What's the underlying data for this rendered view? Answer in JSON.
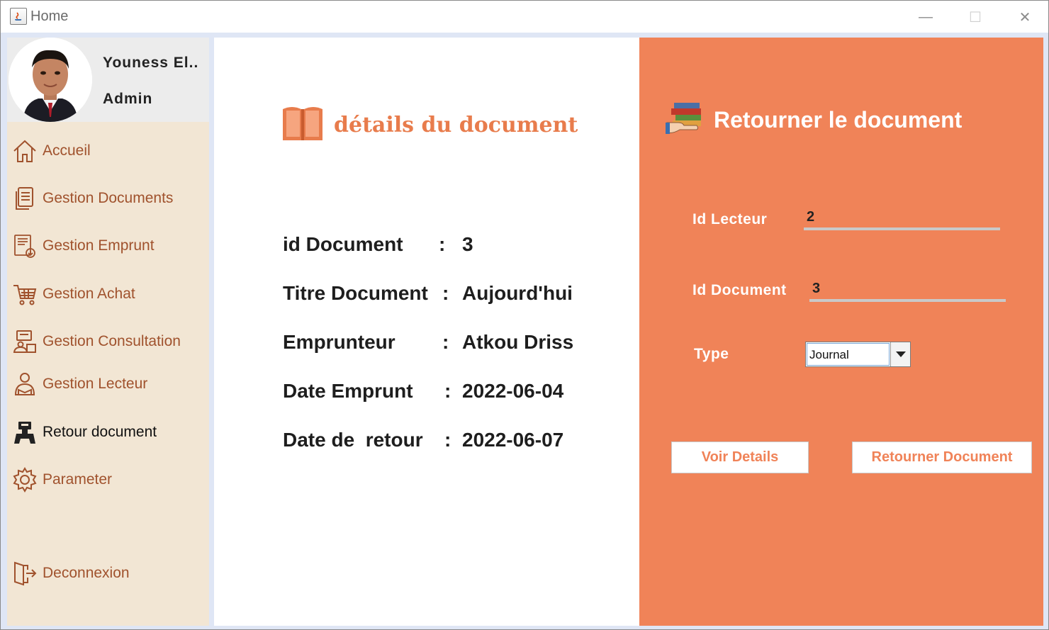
{
  "window": {
    "title": "Home",
    "minimize": "—",
    "maximize": "☐",
    "close": "✕"
  },
  "profile": {
    "name": "Youness El..",
    "role": "Admin"
  },
  "sidebar": {
    "items": [
      {
        "label": "Accueil",
        "icon": "home-icon"
      },
      {
        "label": "Gestion Documents",
        "icon": "documents-icon"
      },
      {
        "label": "Gestion Emprunt",
        "icon": "borrow-icon"
      },
      {
        "label": "Gestion Achat",
        "icon": "cart-icon"
      },
      {
        "label": "Gestion Consultation",
        "icon": "consultation-icon"
      },
      {
        "label": "Gestion Lecteur",
        "icon": "reader-icon"
      },
      {
        "label": "Retour document",
        "icon": "return-icon",
        "active": true
      },
      {
        "label": "Parameter",
        "icon": "gear-icon"
      },
      {
        "label": "Deconnexion",
        "icon": "logout-icon"
      }
    ]
  },
  "details": {
    "header": "détails du document",
    "rows": [
      {
        "label": "id Document",
        "sep": ":",
        "value": "3"
      },
      {
        "label": "Titre Document",
        "sep": ":",
        "value": "Aujourd'hui"
      },
      {
        "label": "Emprunteur",
        "sep": ":",
        "value": "Atkou Driss"
      },
      {
        "label": "Date Emprunt",
        "sep": ":",
        "value": "2022-06-04"
      },
      {
        "label": "Date de  retour",
        "sep": ":",
        "value": "2022-06-07"
      }
    ]
  },
  "return_form": {
    "title": "Retourner le document",
    "id_lecteur_label": "Id Lecteur",
    "id_lecteur_value": "2",
    "id_document_label": "Id Document",
    "id_document_value": "3",
    "type_label": "Type",
    "type_value": "Journal",
    "voir_details_label": "Voir Details",
    "retourner_label": "Retourner Document"
  },
  "colors": {
    "accent": "#f08358",
    "sidebar_bg": "#f2e6d4",
    "nav_text": "#a0522d"
  }
}
